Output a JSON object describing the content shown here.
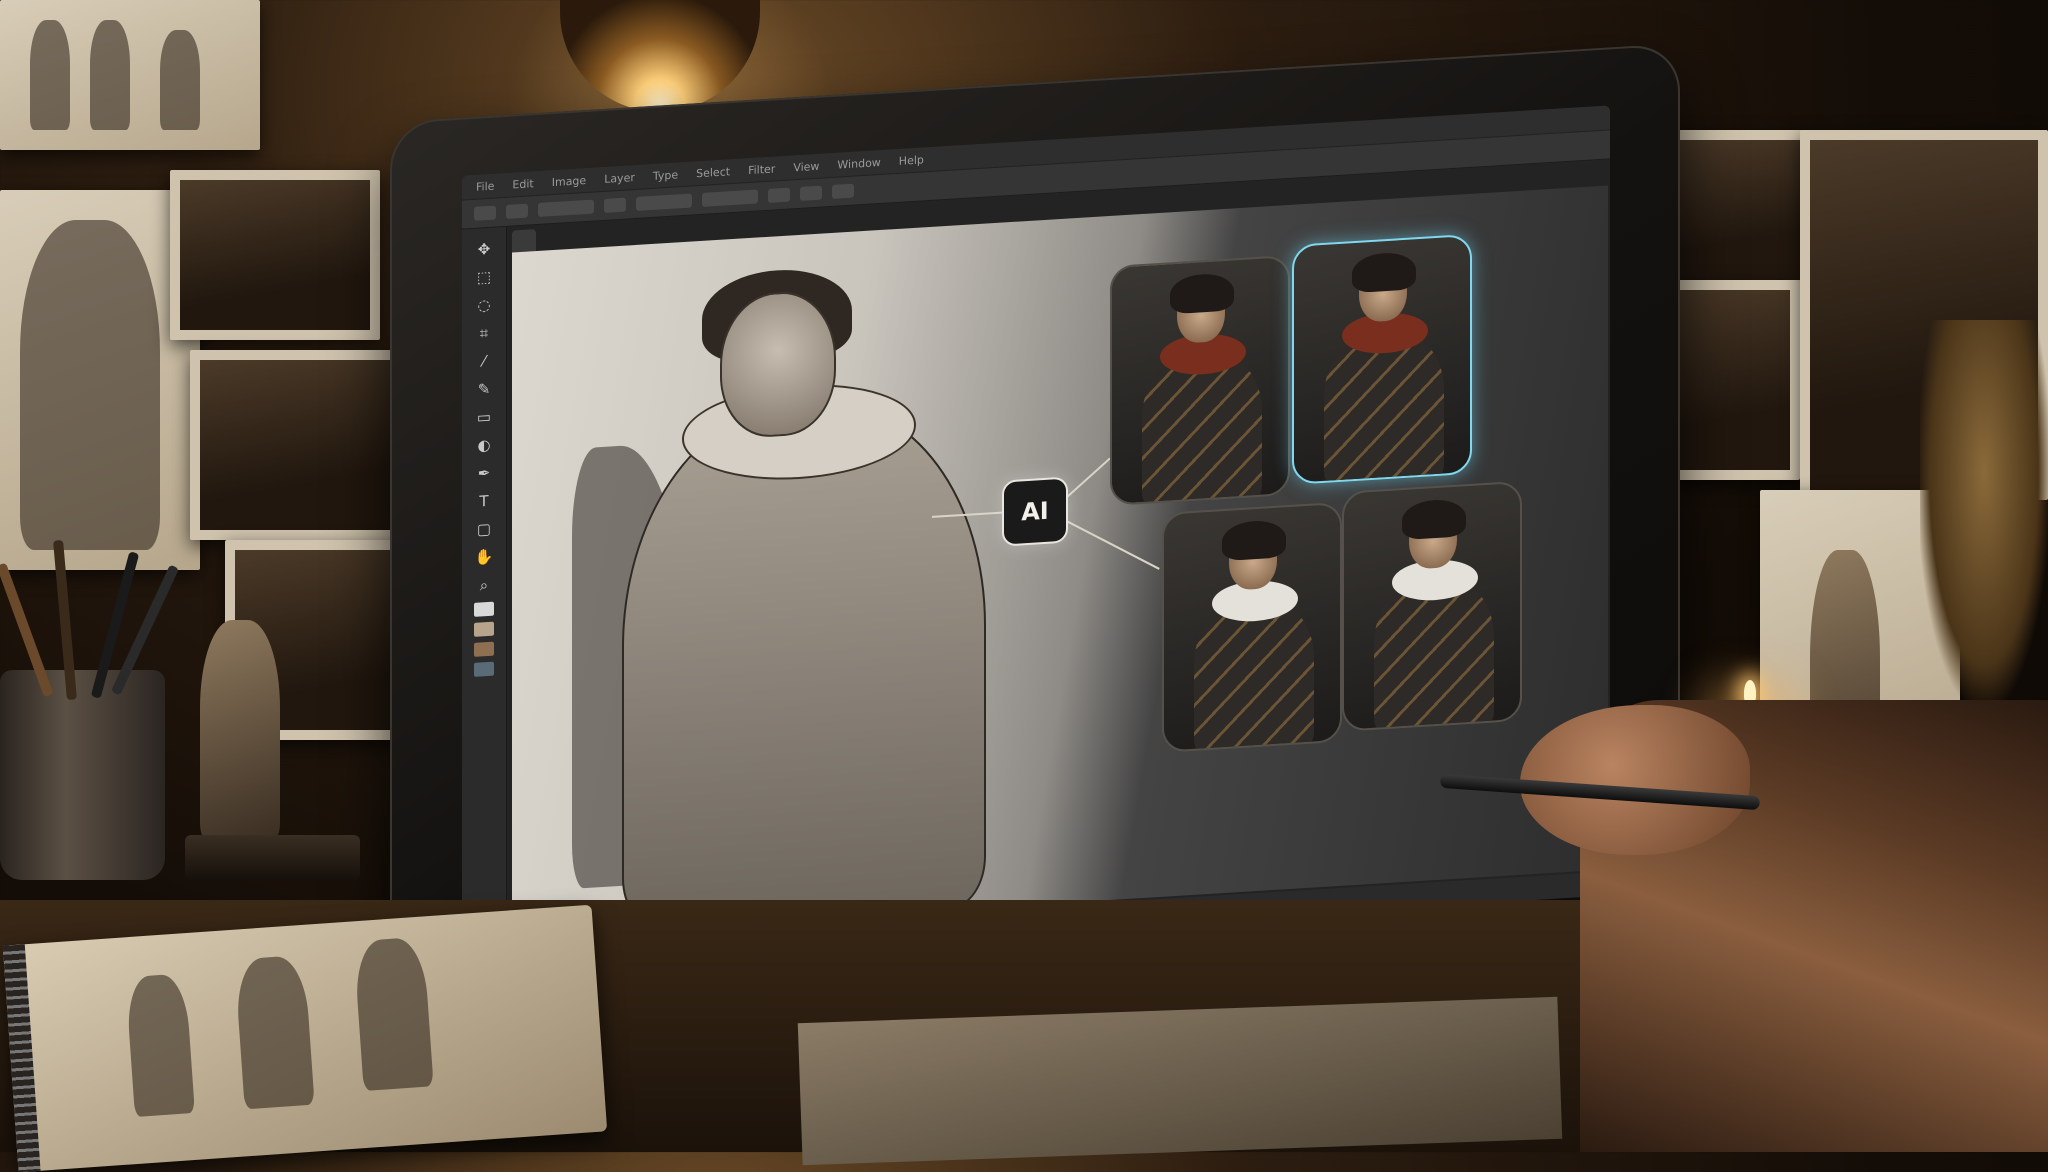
{
  "app": {
    "menu_items": [
      "File",
      "Edit",
      "Image",
      "Layer",
      "Type",
      "Select",
      "Filter",
      "View",
      "Window",
      "Help"
    ],
    "window_title": "",
    "doc_tab": ""
  },
  "ai_node": {
    "label": "AI"
  },
  "variants": [
    {
      "scarf_color": "#7a2e1e",
      "selected": false
    },
    {
      "scarf_color": "#7a2e1e",
      "selected": true
    },
    {
      "scarf_color": "#e4e1da",
      "selected": false
    },
    {
      "scarf_color": "#e4e1da",
      "selected": false
    }
  ],
  "tools": [
    "move-icon",
    "marquee-icon",
    "lasso-icon",
    "crop-icon",
    "eyedropper-icon",
    "brush-icon",
    "eraser-icon",
    "gradient-icon",
    "pen-icon",
    "text-icon",
    "shape-icon",
    "hand-icon",
    "zoom-icon"
  ],
  "swatches": [
    "#d9d9d9",
    "#b7a48a",
    "#8e6f52",
    "#5a6b78"
  ],
  "colors": {
    "selection_glow": "#7fd8ee",
    "lamp_light": "#ffd07a"
  }
}
